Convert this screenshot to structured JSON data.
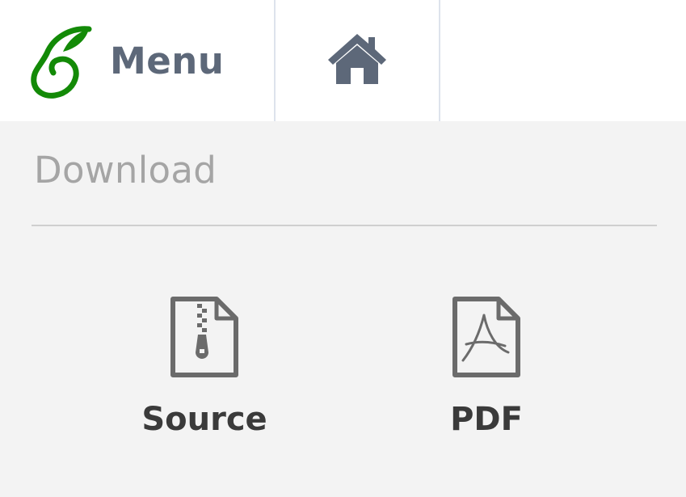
{
  "toolbar": {
    "menu_label": "Menu",
    "logo_icon": "overleaf-sprout-icon",
    "home_icon": "home-icon",
    "colors": {
      "logo_green": "#138a07",
      "icon_gray": "#5d6879",
      "menu_text": "#5d6879"
    }
  },
  "download": {
    "title": "Download",
    "items": [
      {
        "label": "Source",
        "icon": "zip-file-icon"
      },
      {
        "label": "PDF",
        "icon": "pdf-file-icon"
      }
    ],
    "colors": {
      "title": "#a5a5a5",
      "label": "#3a3a3a",
      "icon": "#6b6b6b"
    }
  }
}
